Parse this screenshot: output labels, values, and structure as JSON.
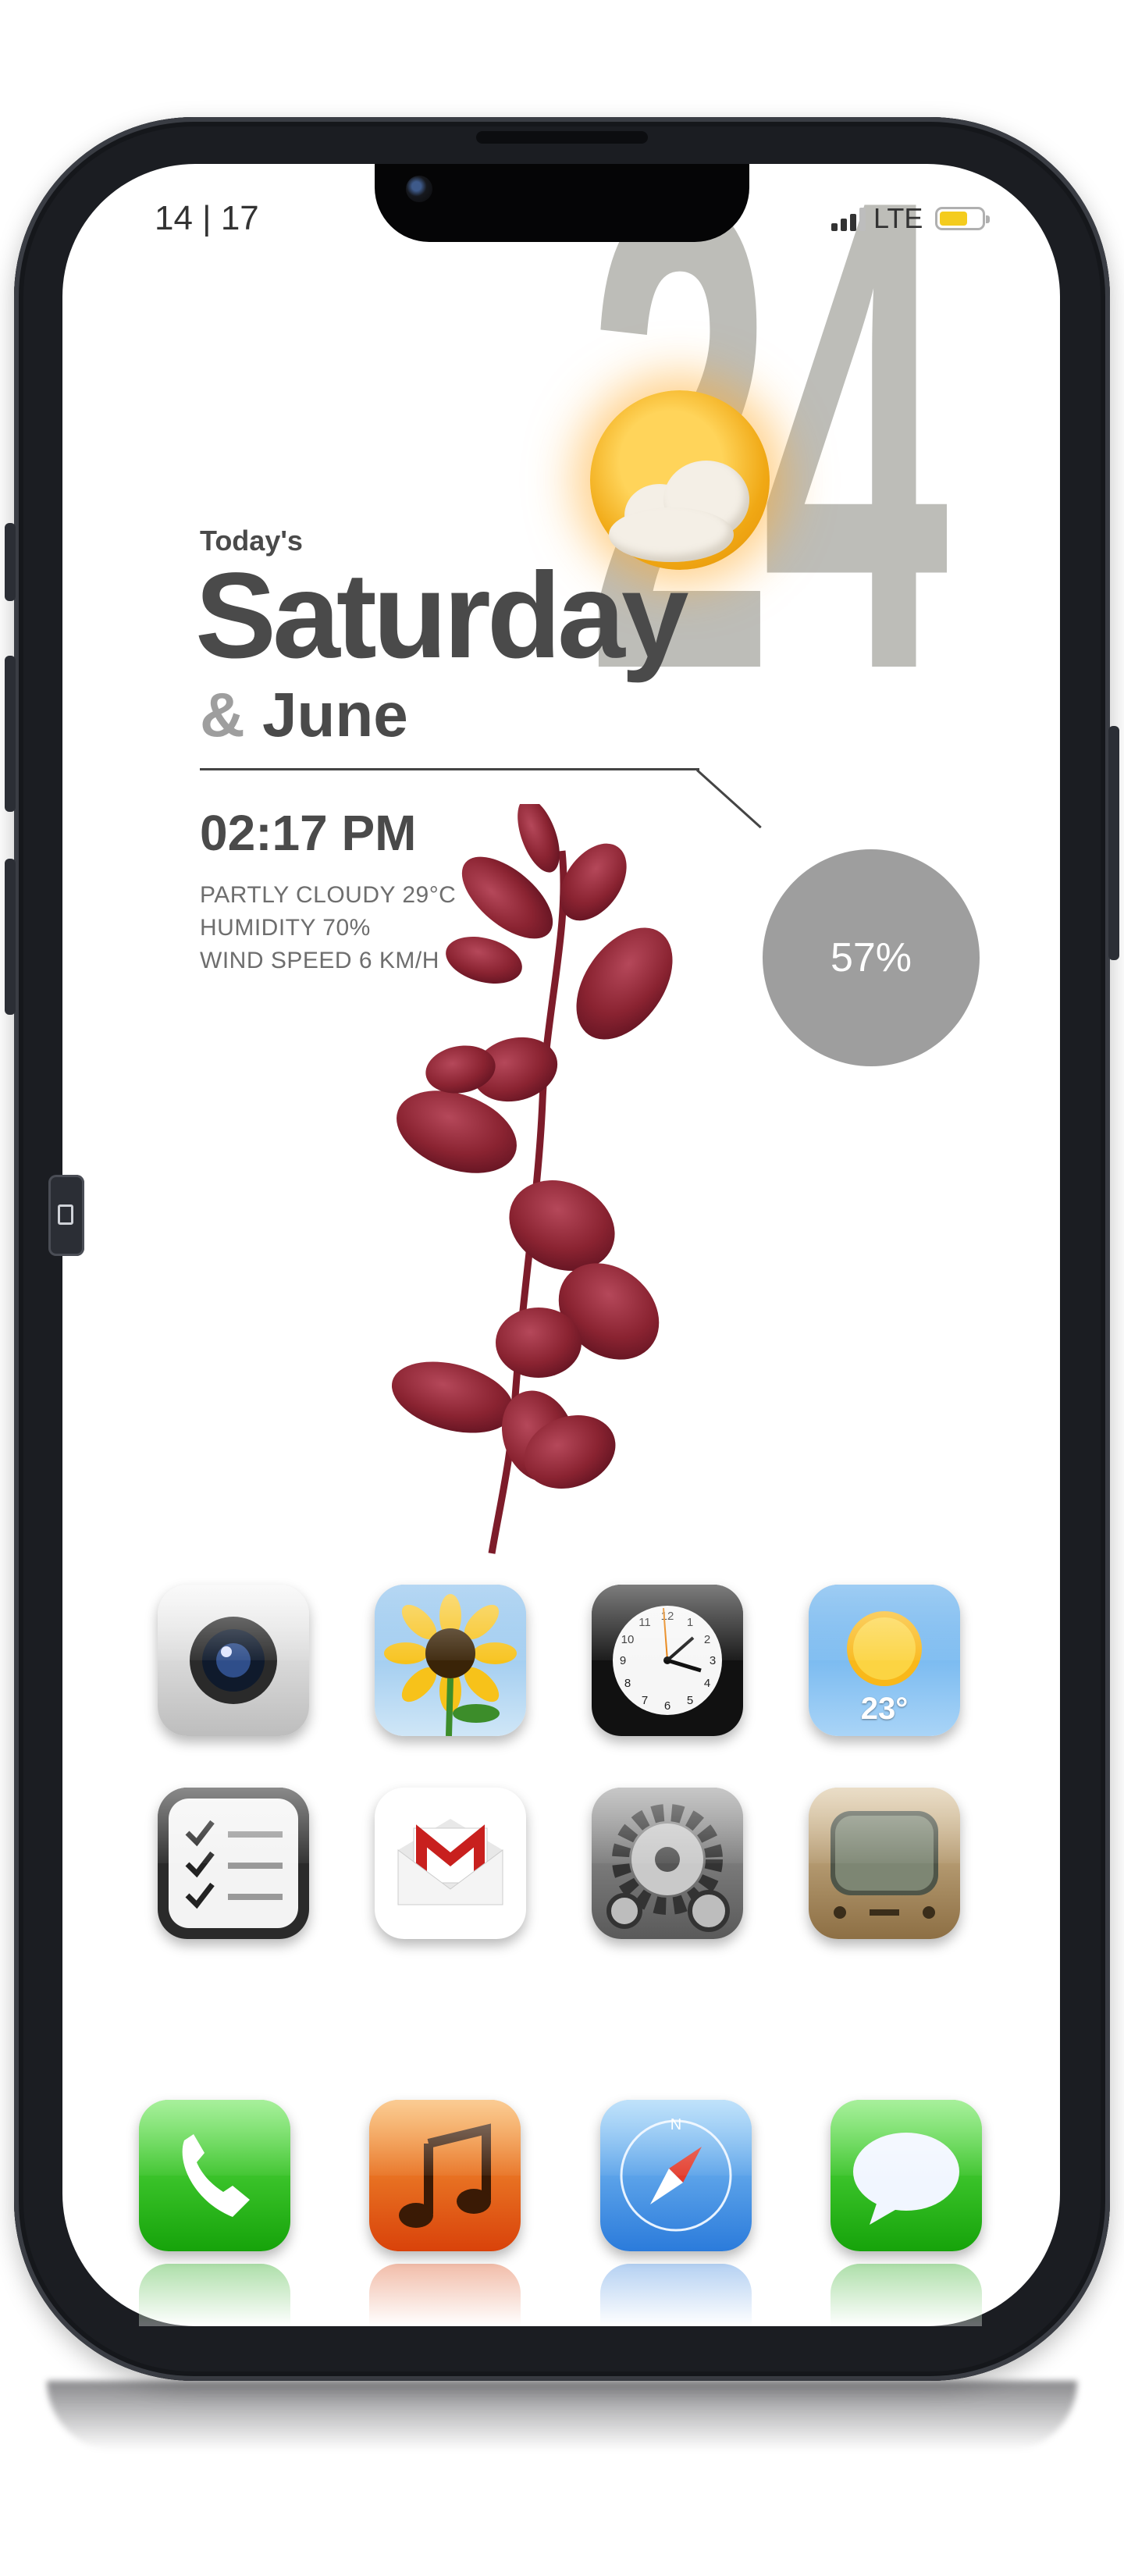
{
  "status_bar": {
    "time": "14 | 17",
    "network": "LTE",
    "signal_bars_on": 3,
    "signal_bars_total": 4,
    "battery_level": 0.7,
    "battery_color": "#f4cc1e"
  },
  "widget": {
    "day_number": "24",
    "weather_icon": "partly-cloudy-icon",
    "todays_label": "Today's",
    "weekday": "Saturday",
    "ampersand": "&",
    "month": "June",
    "time": "02:17 PM",
    "condition": "PARTLY CLOUDY 29°C",
    "humidity": "HUMIDITY 70%",
    "wind": "WIND SPEED 6 KM/H",
    "battery_percent": "57%",
    "accent_grey": "#9e9e9e"
  },
  "apps": {
    "row1": [
      {
        "name": "Camera",
        "icon": "camera-icon"
      },
      {
        "name": "Photos",
        "icon": "sunflower-icon"
      },
      {
        "name": "Clock",
        "icon": "clock-icon"
      },
      {
        "name": "Weather",
        "icon": "weather-sun-icon",
        "temp": "23°"
      }
    ],
    "row2": [
      {
        "name": "Reminders",
        "icon": "checklist-icon"
      },
      {
        "name": "Gmail",
        "icon": "gmail-icon"
      },
      {
        "name": "Settings",
        "icon": "gears-icon"
      },
      {
        "name": "YouTube",
        "icon": "tv-icon"
      }
    ],
    "dock": [
      {
        "name": "Phone",
        "icon": "phone-icon",
        "color": "#2fbd1f"
      },
      {
        "name": "Music",
        "icon": "music-note-icon",
        "color": "#f07a10"
      },
      {
        "name": "Safari",
        "icon": "compass-icon",
        "color": "#3f8fe6"
      },
      {
        "name": "Messages",
        "icon": "speech-bubble-icon",
        "color": "#2fbd1f"
      }
    ]
  }
}
